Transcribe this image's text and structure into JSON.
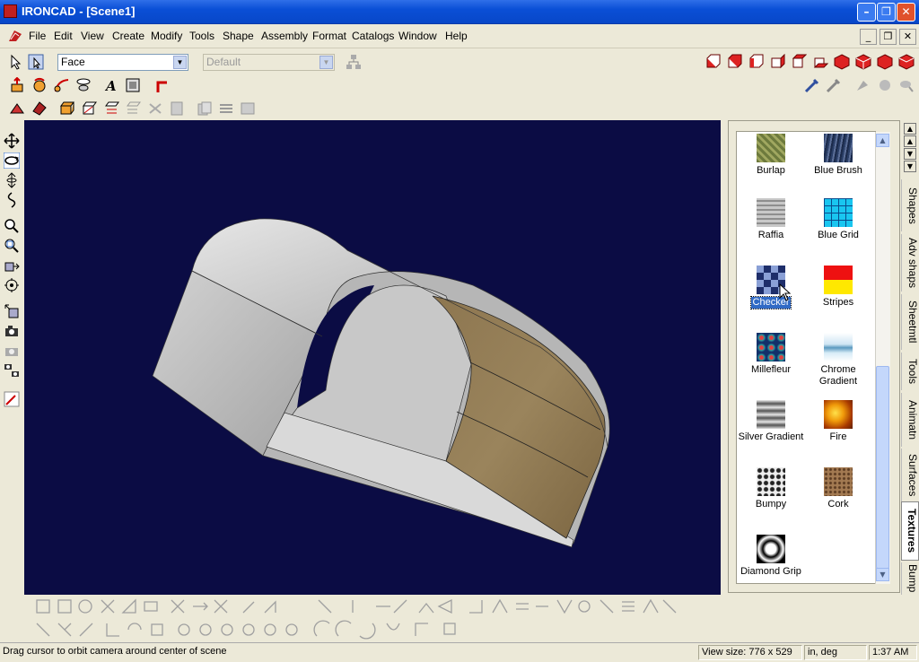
{
  "window": {
    "title": "IRONCAD - [Scene1]"
  },
  "menu": [
    "File",
    "Edit",
    "View",
    "Create",
    "Modify",
    "Tools",
    "Shape",
    "Assembly",
    "Format",
    "Catalogs",
    "Window",
    "Help"
  ],
  "toolbar": {
    "selection_filter": "Face",
    "style_combo": "Default"
  },
  "catalog": {
    "items": [
      {
        "label": "Burlap",
        "icon": "burlap-swatch"
      },
      {
        "label": "Blue Brush",
        "icon": "blue-brush-swatch"
      },
      {
        "label": "Raffia",
        "icon": "raffia-swatch"
      },
      {
        "label": "Blue Grid",
        "icon": "blue-grid-swatch"
      },
      {
        "label": "Checker",
        "icon": "checker-swatch",
        "selected": true
      },
      {
        "label": "Stripes",
        "icon": "stripes-swatch"
      },
      {
        "label": "Millefleur",
        "icon": "millefleur-swatch"
      },
      {
        "label": "Chrome Gradient",
        "icon": "chrome-gradient-swatch"
      },
      {
        "label": "Silver Gradient",
        "icon": "silver-gradient-swatch"
      },
      {
        "label": "Fire",
        "icon": "fire-swatch"
      },
      {
        "label": "Bumpy",
        "icon": "bumpy-swatch"
      },
      {
        "label": "Cork",
        "icon": "cork-swatch"
      },
      {
        "label": "Diamond Grip",
        "icon": "diamond-grip-swatch"
      }
    ],
    "tabs": [
      "Shapes",
      "Adv shaps",
      "Sheetmtl",
      "Tools",
      "Animatn",
      "Surfaces",
      "Textures",
      "Bump"
    ],
    "active_tab": "Textures"
  },
  "status": {
    "message": "Drag cursor to orbit camera around center of scene",
    "view_size": "View size:  776 x  529",
    "units": "in, deg",
    "time": "1:37 AM"
  },
  "colors": {
    "viewport_bg": "#0b0c44",
    "selection": "#316ac5",
    "titlebar": "#0a4fd6"
  }
}
